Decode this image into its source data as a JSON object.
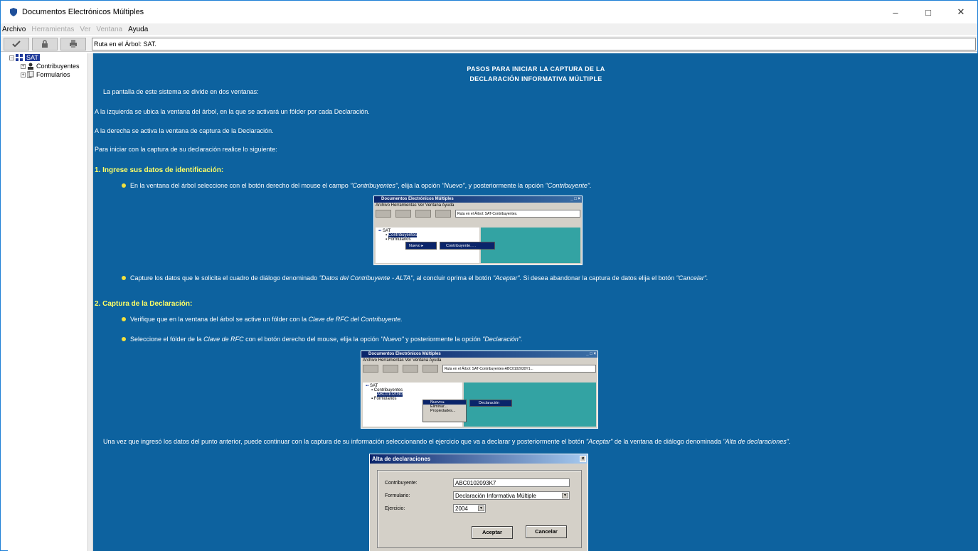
{
  "window": {
    "title": "Documentos Electrónicos Múltiples"
  },
  "menu": [
    {
      "label": "Archivo",
      "enabled": true
    },
    {
      "label": "Herramientas",
      "enabled": false
    },
    {
      "label": "Ver",
      "enabled": false
    },
    {
      "label": "Ventana",
      "enabled": false
    },
    {
      "label": "Ayuda",
      "enabled": true
    }
  ],
  "toolbar": {
    "path": "Ruta en el Árbol: SAT."
  },
  "tree": {
    "root": "SAT",
    "items": [
      "Contribuyentes",
      "Formularios"
    ]
  },
  "content": {
    "heading_line1": "PASOS PARA INICIAR LA CAPTURA DE LA",
    "heading_line2": "DECLARACIÓN INFORMATIVA MÚLTIPLE",
    "intro": "La pantalla de este sistema se divide en dos ventanas:",
    "p_left": "A la izquierda se ubica la ventana del árbol, en la que se activará un fólder por cada Declaración.",
    "p_right": "A la derecha se activa la ventana de captura de la Declaración.",
    "p_start": "Para iniciar con la captura de su declaración realice lo siguiente:",
    "section1": "1. Ingrese sus datos de identificación:",
    "s1_b1_pre": "En la ventana del árbol seleccione con el botón derecho del mouse el campo ",
    "s1_b1_em1": "\"Contribuyentes\"",
    "s1_b1_mid": ", elija la opción ",
    "s1_b1_em2": "\"Nuevo\"",
    "s1_b1_mid2": ", y posteriormente la opción ",
    "s1_b1_em3": "\"Contribuyente\".",
    "s1_b2_pre": "Capture los datos que le solicita el cuadro de diálogo denominado ",
    "s1_b2_em1": "\"Datos del Contribuyente - ALTA\"",
    "s1_b2_mid": ", al concluir oprima el botón ",
    "s1_b2_em2": "\"Aceptar\".",
    "s1_b2_mid2": " Si desea abandonar la captura de datos elija el botón ",
    "s1_b2_em3": "\"Cancelar\".",
    "section2": "2. Captura de la Declaración:",
    "s2_b1_pre": "Verifique que en la ventana del árbol se active un fólder con la ",
    "s2_b1_em": "Clave de RFC del Contribuyente.",
    "s2_b2_pre": "Seleccione el fólder de la ",
    "s2_b2_em1": "Clave de RFC",
    "s2_b2_mid": " con el botón derecho del mouse, elija la opción ",
    "s2_b2_em2": "\"Nuevo\"",
    "s2_b2_mid2": " y posteriormente la opción ",
    "s2_b2_em3": "\"Declaración\".",
    "final_pre": "Una vez que ingresó los datos del punto anterior, puede continuar con la captura de su información seleccionando el ejercicio que va a declarar y posteriormente el botón ",
    "final_em1": "\"Aceptar\"",
    "final_mid": " de la ventana de diálogo denominada ",
    "final_em2": "\"Alta de declaraciones\"."
  },
  "mini1": {
    "title": "Documentos Electrónicos Múltiples",
    "menu": "Archivo  Herramientas  Ver  Ventana  Ayuda",
    "path": "Ruta en el Árbol: SAT-Contribuyentes.",
    "tree_root": "SAT",
    "tree_item": "Contribuyentes",
    "tree_item2": "Formularios",
    "ctx_item": "Nuevo",
    "sub_item": "Contribuyente. . ."
  },
  "mini2": {
    "title": "Documentos Electrónicos Múltiples",
    "menu": "Archivo  Herramientas  Ver  Ventana  Ayuda",
    "path": "Ruta en el Árbol: SAT-Contribuyentes-ABC0102030Y1...",
    "tree_root": "SAT",
    "tree_item": "Contribuyentes",
    "folder": "ABC0102030",
    "tree_item2": "Formularios",
    "ctx_items": [
      "Nuevo",
      "Eliminar...",
      "Propiedades..."
    ],
    "sub_item": "Declaración"
  },
  "dialog": {
    "title": "Alta de declaraciones",
    "contribuyente_label": "Contribuyente:",
    "contribuyente_value": "ABC0102093K7",
    "formulario_label": "Formulario:",
    "formulario_value": "Declaración Informativa Múltiple",
    "ejercicio_label": "Ejercicio:",
    "ejercicio_value": "2004",
    "accept": "Aceptar",
    "cancel": "Cancelar"
  },
  "colors": {
    "content_bg": "#0d629f",
    "section_title": "#ffff66",
    "bullet": "#f0e040"
  }
}
